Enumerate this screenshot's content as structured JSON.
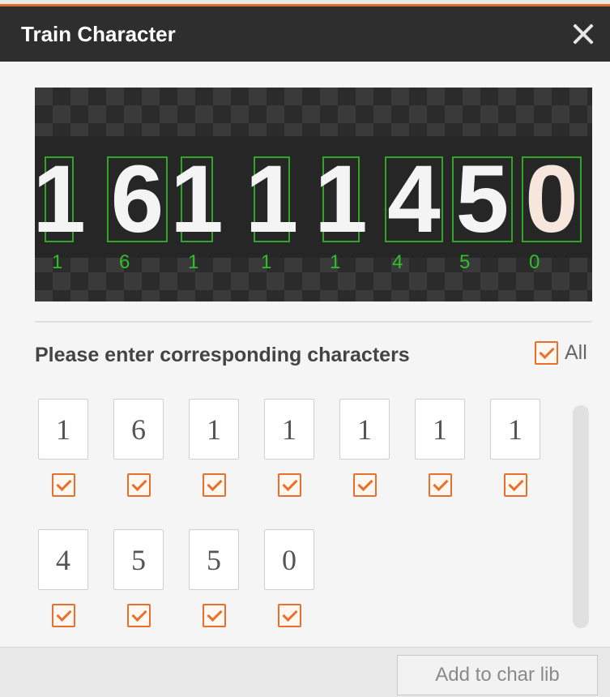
{
  "dialog": {
    "title": "Train Character",
    "close_icon": "close-icon"
  },
  "preview": {
    "recognized": [
      {
        "glyph": "1",
        "label": "1"
      },
      {
        "glyph": "6",
        "label": "6"
      },
      {
        "glyph": "1",
        "label": "1"
      },
      {
        "glyph": "1",
        "label": "1"
      },
      {
        "glyph": "1",
        "label": "1"
      },
      {
        "glyph": "4",
        "label": "4"
      },
      {
        "glyph": "5",
        "label": "5"
      },
      {
        "glyph": "0",
        "label": "0"
      }
    ],
    "box_color": "#2fa52a",
    "label_color": "#2fbf2a"
  },
  "prompt": {
    "text": "Please enter corresponding characters",
    "all_label": "All",
    "all_checked": true
  },
  "characters": [
    {
      "value": "1",
      "checked": true
    },
    {
      "value": "6",
      "checked": true
    },
    {
      "value": "1",
      "checked": true
    },
    {
      "value": "1",
      "checked": true
    },
    {
      "value": "1",
      "checked": true
    },
    {
      "value": "1",
      "checked": true
    },
    {
      "value": "1",
      "checked": true
    },
    {
      "value": "4",
      "checked": true
    },
    {
      "value": "5",
      "checked": true
    },
    {
      "value": "5",
      "checked": true
    },
    {
      "value": "0",
      "checked": true
    }
  ],
  "footer": {
    "add_button": "Add to char lib"
  },
  "colors": {
    "accent": "#e8702c",
    "titlebar": "#2e2e2e"
  }
}
